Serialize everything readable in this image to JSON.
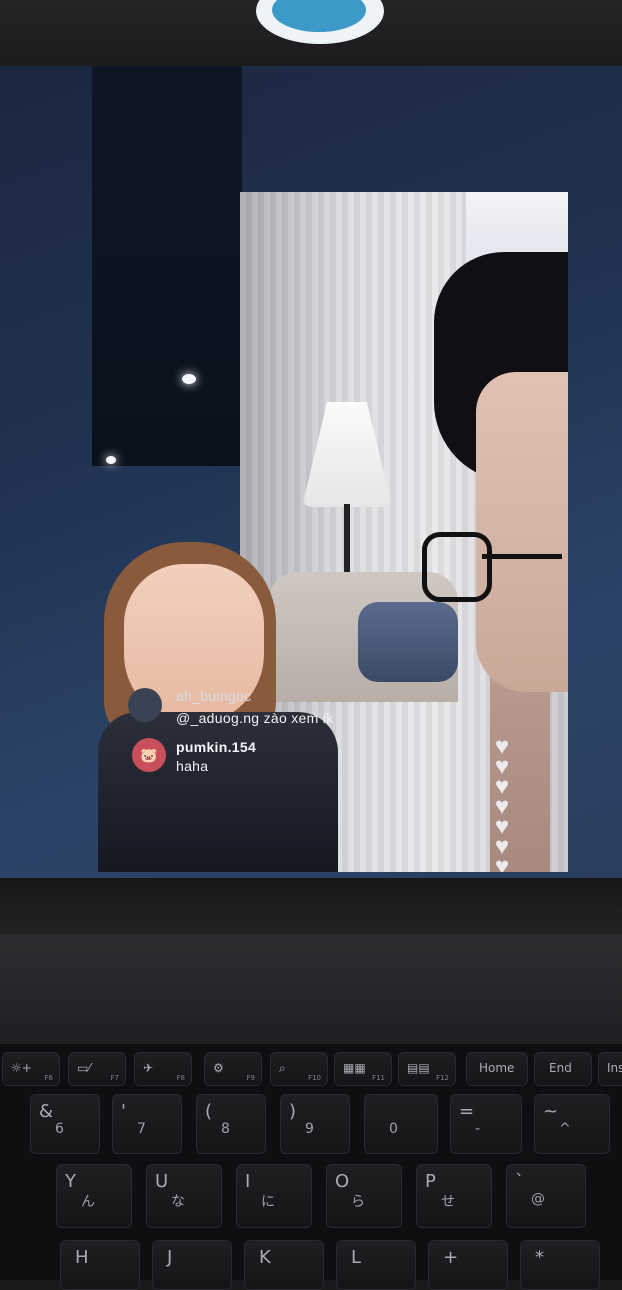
{
  "stream": {
    "comments": [
      {
        "user": "ah_buingoc",
        "text": "@_aduog.ng  zào xem ik"
      },
      {
        "user": "pumkin.154",
        "text": "haha"
      }
    ]
  },
  "keyboard": {
    "function_row": [
      {
        "label": "☼+",
        "sub": "F6"
      },
      {
        "label": "▭⁄",
        "sub": "F7"
      },
      {
        "label": "✈",
        "sub": "F8"
      },
      {
        "label": "⚙",
        "sub": "F9"
      },
      {
        "label": "⌕",
        "sub": "F10"
      },
      {
        "label": "▦▦",
        "sub": "F11"
      },
      {
        "label": "▤▤",
        "sub": "F12"
      },
      {
        "label": "Home",
        "sub": ""
      },
      {
        "label": "End",
        "sub": ""
      },
      {
        "label": "Ins",
        "sub": ""
      }
    ],
    "number_row": [
      {
        "main": "&",
        "alt": "6"
      },
      {
        "main": "'",
        "alt": "7"
      },
      {
        "main": "(",
        "alt": "8"
      },
      {
        "main": ")",
        "alt": "9"
      },
      {
        "main": "",
        "alt": "0"
      },
      {
        "main": "=",
        "alt": "-"
      },
      {
        "main": "~",
        "alt": "^"
      }
    ],
    "letter_row": [
      {
        "main": "Y",
        "alt": "ん"
      },
      {
        "main": "U",
        "alt": "な"
      },
      {
        "main": "I",
        "alt": "に"
      },
      {
        "main": "O",
        "alt": "ら"
      },
      {
        "main": "P",
        "alt": "せ"
      },
      {
        "main": "`",
        "alt": "@"
      }
    ],
    "bottom_row": [
      "H",
      "J",
      "K",
      "L",
      "+",
      "*"
    ]
  }
}
